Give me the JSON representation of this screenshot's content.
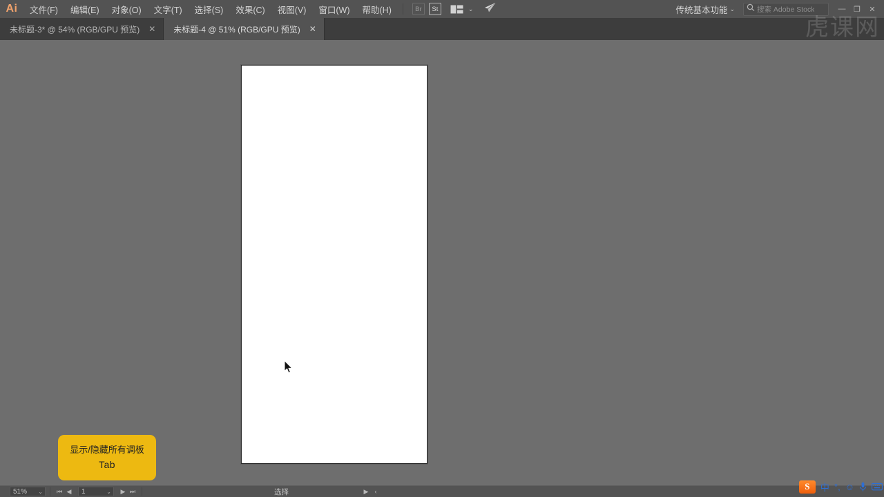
{
  "app": {
    "logo_text": "Ai",
    "watermark": "虎课网"
  },
  "menubar": {
    "items": [
      {
        "label": "文件(F)"
      },
      {
        "label": "编辑(E)"
      },
      {
        "label": "对象(O)"
      },
      {
        "label": "文字(T)"
      },
      {
        "label": "选择(S)"
      },
      {
        "label": "效果(C)"
      },
      {
        "label": "视图(V)"
      },
      {
        "label": "窗口(W)"
      },
      {
        "label": "帮助(H)"
      }
    ],
    "bridge_button": "Br",
    "stock_button": "St",
    "arrange_icon": "arrange-documents-icon",
    "arrange_chevron": "⌄",
    "rocket_icon": "rocket-icon",
    "workspace_name": "传统基本功能",
    "workspace_chevron": "⌄",
    "search_icon": "search-icon",
    "search_placeholder": "搜索 Adobe Stock",
    "window_minimize": "—",
    "window_maximize": "❐",
    "window_close": "✕"
  },
  "tabs": [
    {
      "label": "未标题-3* @ 54% (RGB/GPU 预览)",
      "close": "✕",
      "active": false
    },
    {
      "label": "未标题-4 @ 51% (RGB/GPU 预览)",
      "close": "✕",
      "active": true
    }
  ],
  "canvas": {
    "artboard_fill": "#ffffff",
    "background": "#6e6e6e",
    "cursor_icon": "arrow-cursor"
  },
  "tooltip": {
    "line1": "显示/隐藏所有调板",
    "line2": "Tab",
    "background": "#edb911"
  },
  "statusbar": {
    "zoom_value": "51%",
    "zoom_chevron": "⌄",
    "nav_first": "⏮",
    "nav_prev": "◀",
    "page_value": "1",
    "page_chevron": "⌄",
    "nav_next": "▶",
    "nav_last": "⏭",
    "tool_status": "选择",
    "status_arrow": "▶",
    "status_chevron": "‹"
  },
  "ime": {
    "logo": "S",
    "mode": "中",
    "punctuation": "°,",
    "smiley": "☺",
    "microphone": "🎤",
    "keyboard": "⌨"
  }
}
